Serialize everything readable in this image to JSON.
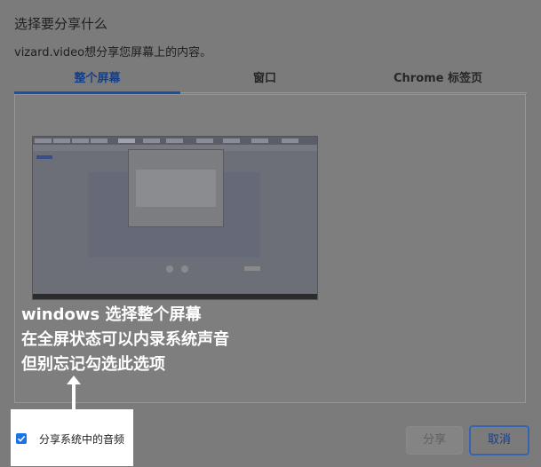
{
  "dialog": {
    "title": "选择要分享什么",
    "subtitle": "vizard.video想分享您屏幕上的内容。"
  },
  "tabs": [
    {
      "label": "整个屏幕",
      "active": true
    },
    {
      "label": "窗口",
      "active": false
    },
    {
      "label": "Chrome 标签页",
      "active": false
    }
  ],
  "annotation": {
    "line1": "windows 选择整个屏幕",
    "line2": "在全屏状态可以内录系统声音",
    "line3": "但别忘记勾选此选项"
  },
  "audio_option": {
    "label": "分享系统中的音频",
    "checked": true
  },
  "buttons": {
    "share": "分享",
    "cancel": "取消"
  },
  "colors": {
    "accent": "#1a4fa8",
    "checkbox": "#1a73e8"
  }
}
